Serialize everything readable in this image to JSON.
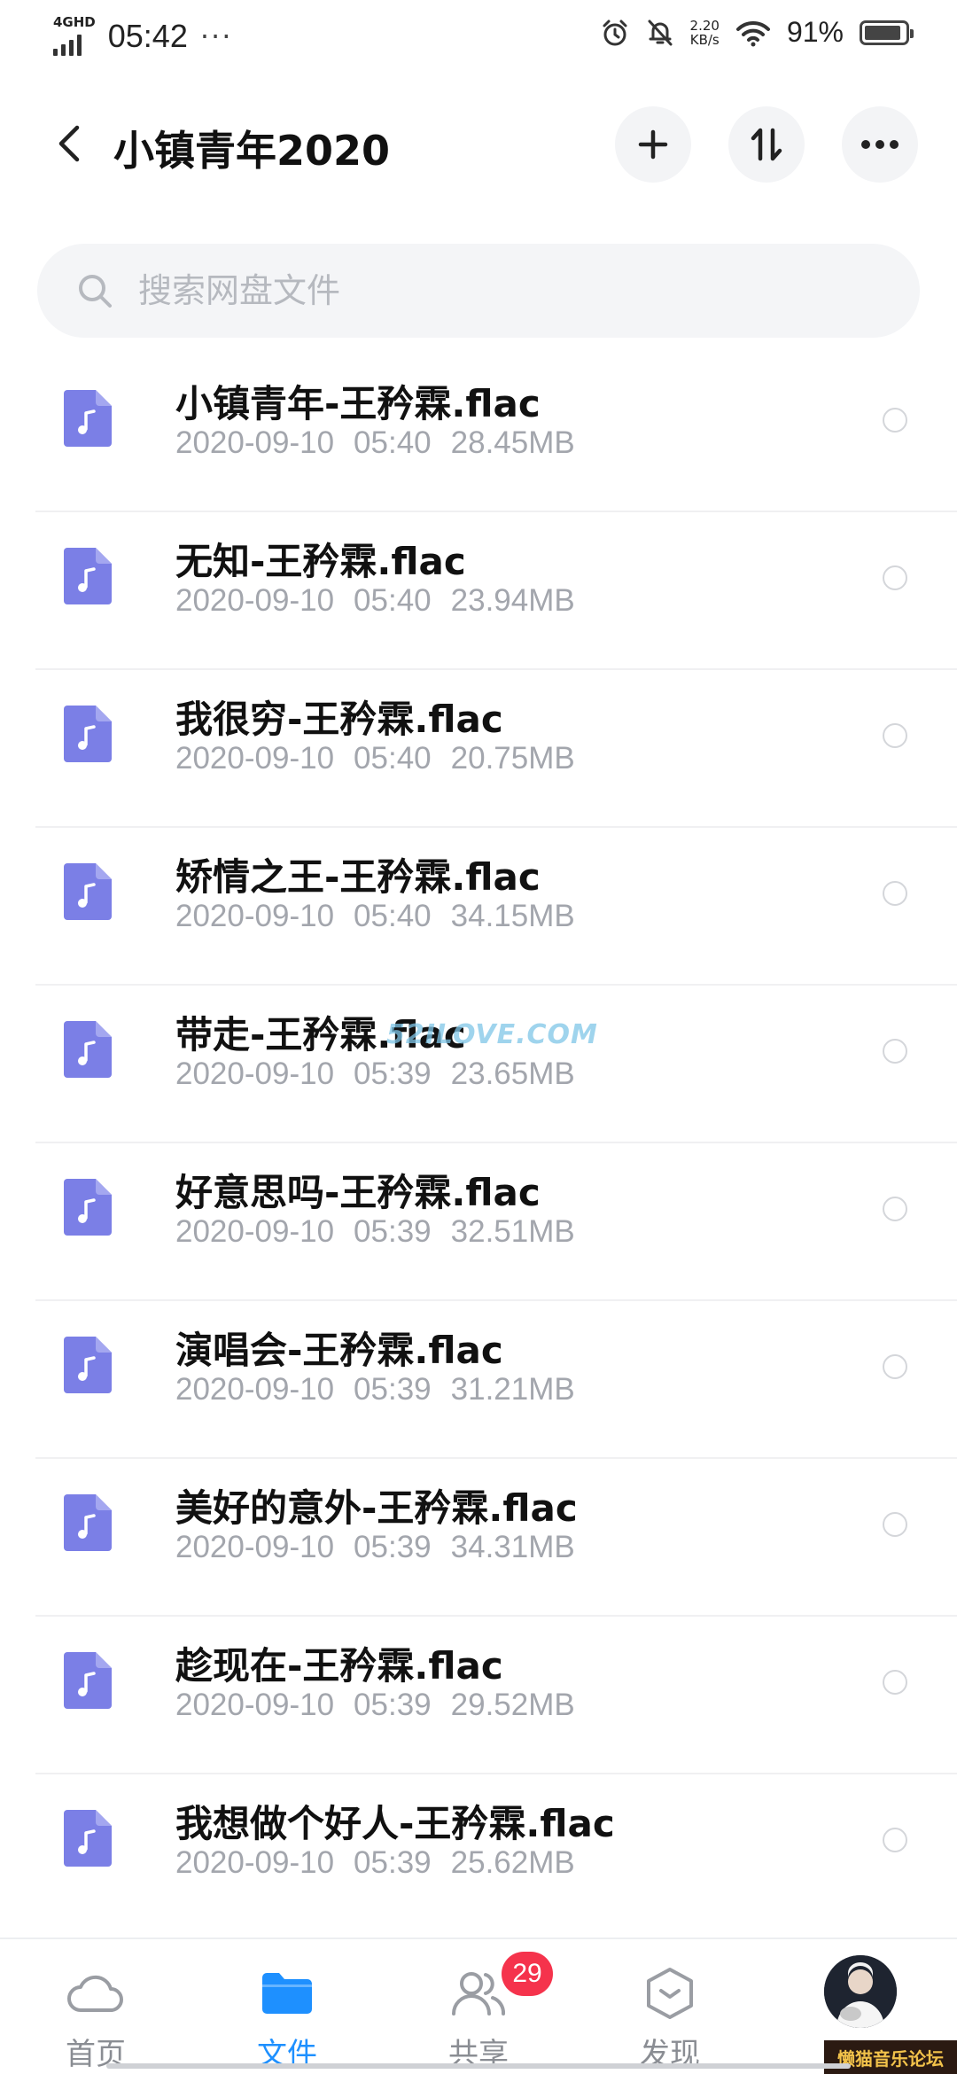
{
  "status_bar": {
    "network": "4GHD",
    "time": "05:42",
    "overflow": "···",
    "speed_value": "2.20",
    "speed_unit": "KB/s",
    "battery_pct": "91%",
    "battery_level": 0.91
  },
  "header": {
    "title": "小镇青年2020",
    "icons": [
      "back-arrow-icon",
      "plus-icon",
      "sort-icon",
      "more-icon"
    ]
  },
  "search": {
    "placeholder": "搜索网盘文件"
  },
  "files": [
    {
      "name": "小镇青年-王矜霖.flac",
      "date": "2020-09-10",
      "time": "05:40",
      "size": "28.45MB"
    },
    {
      "name": "无知-王矜霖.flac",
      "date": "2020-09-10",
      "time": "05:40",
      "size": "23.94MB"
    },
    {
      "name": "我很穷-王矜霖.flac",
      "date": "2020-09-10",
      "time": "05:40",
      "size": "20.75MB"
    },
    {
      "name": "矫情之王-王矜霖.flac",
      "date": "2020-09-10",
      "time": "05:40",
      "size": "34.15MB"
    },
    {
      "name": "带走-王矜霖.flac",
      "date": "2020-09-10",
      "time": "05:39",
      "size": "23.65MB"
    },
    {
      "name": "好意思吗-王矜霖.flac",
      "date": "2020-09-10",
      "time": "05:39",
      "size": "32.51MB"
    },
    {
      "name": "演唱会-王矜霖.flac",
      "date": "2020-09-10",
      "time": "05:39",
      "size": "31.21MB"
    },
    {
      "name": "美好的意外-王矜霖.flac",
      "date": "2020-09-10",
      "time": "05:39",
      "size": "34.31MB"
    },
    {
      "name": "趁现在-王矜霖.flac",
      "date": "2020-09-10",
      "time": "05:39",
      "size": "29.52MB"
    },
    {
      "name": "我想做个好人-王矜霖.flac",
      "date": "2020-09-10",
      "time": "05:39",
      "size": "25.62MB"
    }
  ],
  "watermark": "52ILOVE.COM",
  "tabs": [
    {
      "label": "首页",
      "icon": "cloud-icon"
    },
    {
      "label": "文件",
      "icon": "folder-icon",
      "active": true
    },
    {
      "label": "共享",
      "icon": "people-icon"
    },
    {
      "label": "发现",
      "icon": "discover-icon"
    }
  ],
  "share_badge": "29",
  "forum_stamp": "懒猫音乐论坛",
  "colors": {
    "accent": "#1e90ff",
    "file_icon": "#7b7fe6",
    "badge": "#f5334c"
  }
}
